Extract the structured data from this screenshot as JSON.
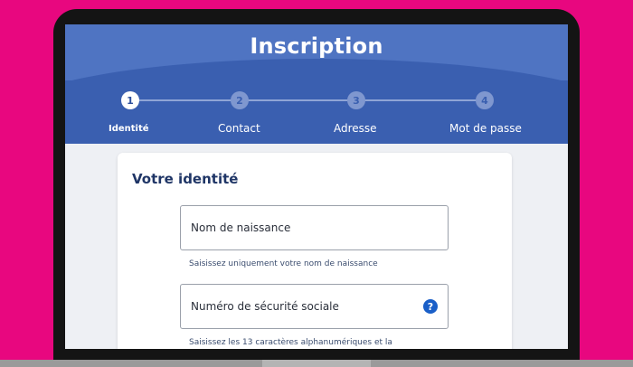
{
  "page": {
    "title": "Inscription"
  },
  "stepper": {
    "steps": [
      {
        "number": "1",
        "label": "Identité",
        "state": "active"
      },
      {
        "number": "2",
        "label": "Contact",
        "state": "inactive"
      },
      {
        "number": "3",
        "label": "Adresse",
        "state": "inactive"
      },
      {
        "number": "4",
        "label": "Mot de passe",
        "state": "inactive"
      }
    ]
  },
  "form": {
    "section_title": "Votre identité",
    "fields": [
      {
        "label": "Nom de naissance",
        "help": "Saisissez uniquement votre nom de naissance"
      },
      {
        "label": "Numéro de sécurité sociale",
        "help": "Saisissez les 13 caractères alphanumériques et la",
        "help_icon": "question-icon",
        "help_icon_glyph": "?"
      }
    ]
  },
  "colors": {
    "background": "#e8077f",
    "header": "#3a5fb0",
    "header_light": "#4f74c2",
    "card": "#ffffff",
    "accent": "#1a5fc8"
  }
}
